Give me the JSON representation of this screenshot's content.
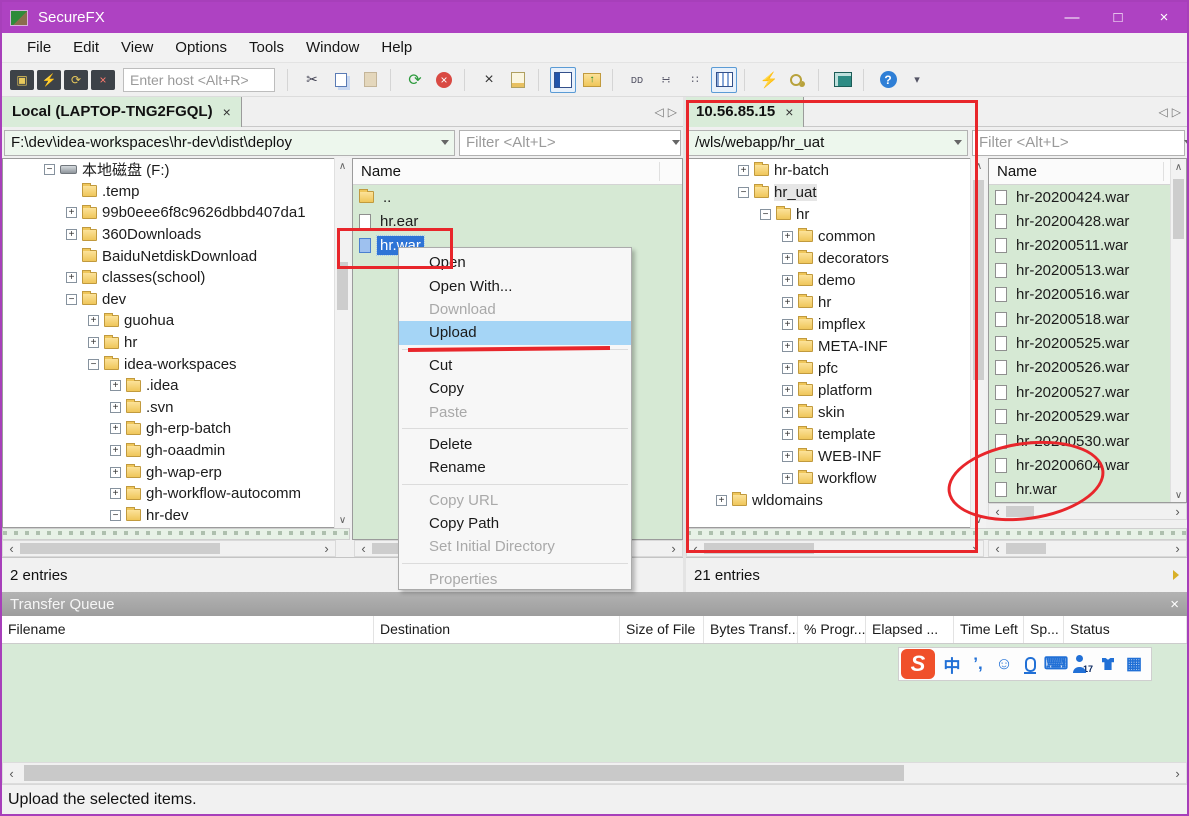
{
  "window": {
    "title": "SecureFX",
    "controls": {
      "minimize": "—",
      "maximize": "□",
      "close": "×"
    }
  },
  "icons": {
    "close": "×",
    "prev": "◁",
    "next": "▷",
    "left": "‹",
    "right": "›",
    "up": "∧",
    "down": "∨"
  },
  "menu_bar": {
    "items": [
      {
        "name": "menu-file",
        "label": "File"
      },
      {
        "name": "menu-edit",
        "label": "Edit"
      },
      {
        "name": "menu-view",
        "label": "View"
      },
      {
        "name": "menu-options",
        "label": "Options"
      },
      {
        "name": "menu-tools",
        "label": "Tools"
      },
      {
        "name": "menu-window",
        "label": "Window"
      },
      {
        "name": "menu-help",
        "label": "Help"
      }
    ]
  },
  "toolbar": {
    "host_placeholder": "Enter host <Alt+R>",
    "buttons_a": [
      {
        "name": "connect-dialog-icon",
        "cls": "tbA",
        "glyph": "▣"
      },
      {
        "name": "quick-connect-icon",
        "cls": "tbA",
        "glyph": "⚡"
      },
      {
        "name": "reconnect-icon",
        "cls": "tbA",
        "glyph": "⟳"
      },
      {
        "name": "disconnect-icon",
        "cls": "tbA i-disc",
        "glyph": "×"
      }
    ],
    "buttons_b": [
      {
        "sep": true
      },
      {
        "name": "cut-icon",
        "glyph": "✂"
      },
      {
        "name": "copy-icon",
        "cls": "i-copy"
      },
      {
        "name": "paste-icon",
        "cls": "i-paste"
      },
      {
        "sep": true
      },
      {
        "name": "refresh-icon",
        "cls": "i-green",
        "glyph": "⟳"
      },
      {
        "name": "stop-icon",
        "cls": "i-stop"
      },
      {
        "sep": true
      },
      {
        "name": "delete-icon",
        "cls": "i-dark",
        "glyph": "×"
      },
      {
        "name": "properties-icon",
        "cls": "i-props"
      },
      {
        "sep": true
      },
      {
        "name": "pane-view-toggle-icon",
        "cls": "i-pane active-tool"
      },
      {
        "name": "parent-directory-icon",
        "cls": "i-folderup"
      },
      {
        "sep": true
      },
      {
        "name": "transfer-ascii-icon",
        "cls": "i-small",
        "glyph": "ᴅᴅ"
      },
      {
        "name": "list-view-icon",
        "cls": "i-small",
        "glyph": "∺"
      },
      {
        "name": "small-list-view-icon",
        "cls": "i-small",
        "glyph": "∷"
      },
      {
        "name": "details-view-icon",
        "cls": "i-grid active-tool"
      },
      {
        "sep": true
      },
      {
        "name": "synchronize-icon",
        "cls": "i-sync",
        "glyph": "⚡"
      },
      {
        "name": "agent-key-icon",
        "cls": "i-key"
      },
      {
        "sep": true
      },
      {
        "name": "vault-icon",
        "cls": "i-vault"
      },
      {
        "sep": true
      },
      {
        "name": "help-icon",
        "cls": "i-help"
      },
      {
        "name": "toolbar-overflow-icon",
        "cls": "i-small",
        "glyph": "▾"
      }
    ]
  },
  "left_panel": {
    "tab": "Local (LAPTOP-TNG2FGQL)",
    "path": "F:\\dev\\idea-workspaces\\hr-dev\\dist\\deploy",
    "filter_placeholder": "Filter <Alt+L>",
    "status": "2 entries",
    "tree": [
      {
        "label": "本地磁盘 (F:)",
        "indent": 1,
        "expander": "minus",
        "icon": "drive"
      },
      {
        "label": ".temp",
        "indent": 2,
        "expander": "none",
        "icon": "folder"
      },
      {
        "label": "99b0eee6f8c9626dbbd407da1",
        "indent": 2,
        "expander": "plus",
        "icon": "folder"
      },
      {
        "label": "360Downloads",
        "indent": 2,
        "expander": "plus",
        "icon": "folder"
      },
      {
        "label": "BaiduNetdiskDownload",
        "indent": 2,
        "expander": "none",
        "icon": "folder"
      },
      {
        "label": "classes(school)",
        "indent": 2,
        "expander": "plus",
        "icon": "folder"
      },
      {
        "label": "dev",
        "indent": 2,
        "expander": "minus",
        "icon": "folder"
      },
      {
        "label": "guohua",
        "indent": 3,
        "expander": "plus",
        "icon": "folder"
      },
      {
        "label": "hr",
        "indent": 3,
        "expander": "plus",
        "icon": "folder"
      },
      {
        "label": "idea-workspaces",
        "indent": 3,
        "expander": "minus",
        "icon": "folder"
      },
      {
        "label": ".idea",
        "indent": 4,
        "expander": "plus",
        "icon": "folder"
      },
      {
        "label": ".svn",
        "indent": 4,
        "expander": "plus",
        "icon": "folder"
      },
      {
        "label": "gh-erp-batch",
        "indent": 4,
        "expander": "plus",
        "icon": "folder"
      },
      {
        "label": "gh-oaadmin",
        "indent": 4,
        "expander": "plus",
        "icon": "folder"
      },
      {
        "label": "gh-wap-erp",
        "indent": 4,
        "expander": "plus",
        "icon": "folder"
      },
      {
        "label": "gh-workflow-autocomm",
        "indent": 4,
        "expander": "plus",
        "icon": "folder"
      },
      {
        "label": "hr-dev",
        "indent": 4,
        "expander": "minus",
        "icon": "folder"
      }
    ],
    "files": {
      "header": "Name",
      "items": [
        {
          "label": "..",
          "icon": "folder"
        },
        {
          "label": "hr.ear",
          "icon": "file"
        },
        {
          "label": "hr.war",
          "icon": "file-blue",
          "selected": true
        }
      ]
    }
  },
  "right_panel": {
    "tab": "10.56.85.15",
    "path": "/wls/webapp/hr_uat",
    "filter_placeholder": "Filter <Alt+L>",
    "status": "21 entries",
    "tree": [
      {
        "label": "hr-batch",
        "indent": 2,
        "expander": "plus",
        "icon": "folder"
      },
      {
        "label": "hr_uat",
        "indent": 2,
        "expander": "minus",
        "icon": "folder",
        "selected": true
      },
      {
        "label": "hr",
        "indent": 3,
        "expander": "minus",
        "icon": "folder"
      },
      {
        "label": "common",
        "indent": 4,
        "expander": "plus",
        "icon": "folder"
      },
      {
        "label": "decorators",
        "indent": 4,
        "expander": "plus",
        "icon": "folder"
      },
      {
        "label": "demo",
        "indent": 4,
        "expander": "plus",
        "icon": "folder"
      },
      {
        "label": "hr",
        "indent": 4,
        "expander": "plus",
        "icon": "folder"
      },
      {
        "label": "impflex",
        "indent": 4,
        "expander": "plus",
        "icon": "folder"
      },
      {
        "label": "META-INF",
        "indent": 4,
        "expander": "plus",
        "icon": "folder"
      },
      {
        "label": "pfc",
        "indent": 4,
        "expander": "plus",
        "icon": "folder"
      },
      {
        "label": "platform",
        "indent": 4,
        "expander": "plus",
        "icon": "folder"
      },
      {
        "label": "skin",
        "indent": 4,
        "expander": "plus",
        "icon": "folder"
      },
      {
        "label": "template",
        "indent": 4,
        "expander": "plus",
        "icon": "folder"
      },
      {
        "label": "WEB-INF",
        "indent": 4,
        "expander": "plus",
        "icon": "folder"
      },
      {
        "label": "workflow",
        "indent": 4,
        "expander": "plus",
        "icon": "folder"
      },
      {
        "label": "wldomains",
        "indent": 1,
        "expander": "plus",
        "icon": "folder"
      }
    ],
    "files": {
      "header": "Name",
      "items": [
        {
          "label": "hr-20200424.war",
          "icon": "file"
        },
        {
          "label": "hr-20200428.war",
          "icon": "file"
        },
        {
          "label": "hr-20200511.war",
          "icon": "file"
        },
        {
          "label": "hr-20200513.war",
          "icon": "file"
        },
        {
          "label": "hr-20200516.war",
          "icon": "file"
        },
        {
          "label": "hr-20200518.war",
          "icon": "file"
        },
        {
          "label": "hr-20200525.war",
          "icon": "file"
        },
        {
          "label": "hr-20200526.war",
          "icon": "file"
        },
        {
          "label": "hr-20200527.war",
          "icon": "file"
        },
        {
          "label": "hr-20200529.war",
          "icon": "file"
        },
        {
          "label": "hr-20200530.war",
          "icon": "file"
        },
        {
          "label": "hr-20200604.war",
          "icon": "file"
        },
        {
          "label": "hr.war",
          "icon": "file"
        }
      ]
    }
  },
  "context_menu": {
    "items": [
      {
        "label": "Open"
      },
      {
        "label": "Open With..."
      },
      {
        "label": "Download",
        "state": "disabled"
      },
      {
        "label": "Upload",
        "state": "highlight"
      },
      {
        "sep": true
      },
      {
        "label": "Cut"
      },
      {
        "label": "Copy"
      },
      {
        "label": "Paste",
        "state": "disabled"
      },
      {
        "sep": true
      },
      {
        "label": "Delete"
      },
      {
        "label": "Rename"
      },
      {
        "sep": true
      },
      {
        "label": "Copy URL",
        "state": "disabled"
      },
      {
        "label": "Copy Path"
      },
      {
        "label": "Set Initial Directory",
        "state": "disabled"
      },
      {
        "sep": true
      },
      {
        "label": "Properties",
        "state": "disabled"
      }
    ]
  },
  "transfer_queue": {
    "title": "Transfer Queue",
    "columns": [
      {
        "label": "Filename"
      },
      {
        "label": "Destination"
      },
      {
        "label": "Size of File"
      },
      {
        "label": "Bytes Transf..."
      },
      {
        "label": "% Progr..."
      },
      {
        "label": "Elapsed ..."
      },
      {
        "label": "Time Left"
      },
      {
        "label": "Sp..."
      },
      {
        "label": "Status"
      }
    ]
  },
  "ime_toolbar": {
    "buttons": [
      {
        "name": "sogou-logo-icon",
        "cls": "ime-logo",
        "glyph": "S"
      },
      {
        "name": "chinese-mode-icon",
        "glyph": "中"
      },
      {
        "name": "punctuation-icon",
        "glyph": "’,"
      },
      {
        "name": "emoji-icon",
        "glyph": "☺"
      },
      {
        "name": "voice-input-icon",
        "cls": "ime-mic"
      },
      {
        "name": "soft-keyboard-icon",
        "glyph": "⌨"
      },
      {
        "name": "login-badge-icon",
        "cls": "ime-person",
        "glyph": "17"
      },
      {
        "name": "skin-icon",
        "cls": "ime-shirt"
      },
      {
        "name": "toolbox-icon",
        "glyph": "▦"
      }
    ]
  },
  "bottom_status": "Upload the selected items.",
  "annotation_color": "#e8262b"
}
